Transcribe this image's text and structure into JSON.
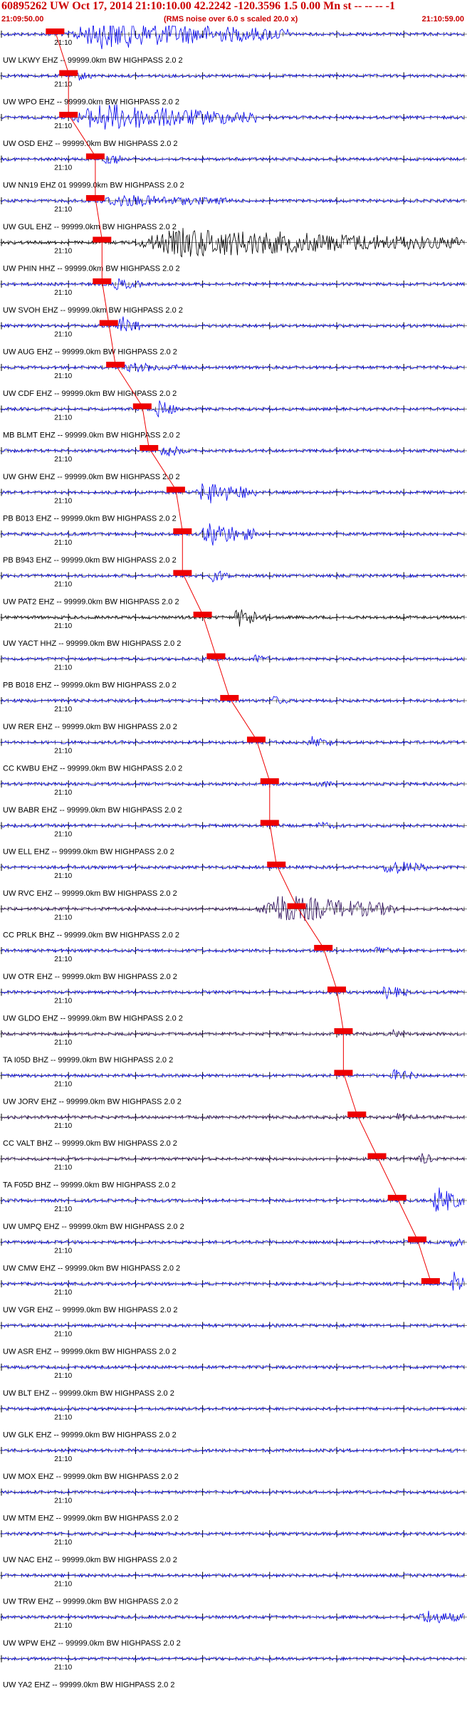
{
  "header": {
    "title": "60895262 UW Oct 17, 2014 21:10:10.00   42.2242 -120.3596  1.5 0.00 Mn st -- -- --  -1",
    "start_time": "21:09:50.00",
    "note": "(RMS noise over 6.0 s scaled 20.0 x)",
    "end_time": "21:10:59.00"
  },
  "colors": {
    "trace_blue": "#0000ee",
    "trace_black": "#000000",
    "trace_purple": "#2a0a5a",
    "pick_red": "#ee0000",
    "title_red": "#cc0000"
  },
  "chart_data": {
    "type": "line",
    "x_range": [
      "21:09:50.00",
      "21:10:59.00"
    ],
    "tick_label": "21:10",
    "traces": [
      {
        "label": "UW LKWY EHZ -- 99999.0km BW HIGHPASS  2.0  2",
        "color": "blue",
        "pick": "21:09:58",
        "amp": 0.95,
        "burst": [
          0.14,
          0.62
        ],
        "dark": false
      },
      {
        "label": "UW WPO EHZ -- 99999.0km BW HIGHPASS  2.0  2",
        "color": "blue",
        "pick": "21:10:00",
        "amp": 0.3,
        "burst": [
          0.15,
          0.2
        ],
        "dark": false
      },
      {
        "label": "UW OSD EHZ -- 99999.0km BW HIGHPASS  2.0  2",
        "color": "blue",
        "pick": "21:10:00",
        "amp": 0.9,
        "burst": [
          0.15,
          0.55
        ],
        "dark": false
      },
      {
        "label": "UW NN19 EHZ 01 99999.0km BW HIGHPASS  2.0  2",
        "color": "blue",
        "pick": "21:10:04",
        "amp": 0.45,
        "burst": [
          0.22,
          0.26
        ],
        "dark": false
      },
      {
        "label": "UW GUL EHZ -- 99999.0km BW HIGHPASS  2.0  2",
        "color": "blue",
        "pick": "21:10:04",
        "amp": 0.35,
        "burst": [
          0.2,
          0.5
        ],
        "dark": false
      },
      {
        "label": "UW PHIN HHZ -- 99999.0km BW HIGHPASS  2.0  2",
        "color": "black",
        "pick": "21:10:05",
        "amp": 0.95,
        "burst": [
          0.28,
          1.0
        ],
        "dark": true
      },
      {
        "label": "UW SVOH EHZ -- 99999.0km BW HIGHPASS  2.0  2",
        "color": "blue",
        "pick": "21:10:05",
        "amp": 0.35,
        "burst": [
          0.24,
          0.3
        ],
        "dark": false
      },
      {
        "label": "UW AUG EHZ -- 99999.0km BW HIGHPASS  2.0  2",
        "color": "blue",
        "pick": "21:10:06",
        "amp": 0.7,
        "burst": [
          0.25,
          0.3
        ],
        "dark": false
      },
      {
        "label": "UW CDF EHZ -- 99999.0km BW HIGHPASS  2.0  2",
        "color": "blue",
        "pick": "21:10:07",
        "amp": 0.25,
        "burst": [
          0.26,
          0.4
        ],
        "dark": false
      },
      {
        "label": "MB BLMT EHZ -- 99999.0km BW HIGHPASS  2.0  2",
        "color": "blue",
        "pick": "21:10:11",
        "amp": 0.55,
        "burst": [
          0.33,
          0.38
        ],
        "dark": false
      },
      {
        "label": "UW GHW EHZ -- 99999.0km BW HIGHPASS  2.0  2",
        "color": "blue",
        "pick": "21:10:12",
        "amp": 0.4,
        "burst": [
          0.34,
          0.4
        ],
        "dark": false
      },
      {
        "label": "PB B013 EHZ -- 99999.0km BW HIGHPASS  2.0  2",
        "color": "blue",
        "pick": "21:10:16",
        "amp": 0.75,
        "burst": [
          0.42,
          0.55
        ],
        "dark": false
      },
      {
        "label": "PB B943 EHZ -- 99999.0km BW HIGHPASS  2.0  2",
        "color": "blue",
        "pick": "21:10:17",
        "amp": 0.8,
        "burst": [
          0.43,
          0.55
        ],
        "dark": false
      },
      {
        "label": "UW PAT2 EHZ -- 99999.0km BW HIGHPASS  2.0  2",
        "color": "blue",
        "pick": "21:10:17",
        "amp": 0.4,
        "burst": [
          0.45,
          0.5
        ],
        "dark": false
      },
      {
        "label": "UW YACT HHZ -- 99999.0km BW HIGHPASS  2.0  2",
        "color": "black",
        "pick": "21:10:20",
        "amp": 0.6,
        "burst": [
          0.5,
          0.58
        ],
        "dark": true
      },
      {
        "label": "PB B018 EHZ -- 99999.0km BW HIGHPASS  2.0  2",
        "color": "blue",
        "pick": "21:10:22",
        "amp": 0.22,
        "burst": [
          0.54,
          0.58
        ],
        "dark": false
      },
      {
        "label": "UW RER EHZ -- 99999.0km BW HIGHPASS  2.0  2",
        "color": "blue",
        "pick": "21:10:24",
        "amp": 0.25,
        "burst": [
          0.58,
          0.62
        ],
        "dark": false
      },
      {
        "label": "CC KWBU EHZ -- 99999.0km BW HIGHPASS  2.0  2",
        "color": "blue",
        "pick": "21:10:28",
        "amp": 0.35,
        "burst": [
          0.66,
          0.72
        ],
        "dark": false
      },
      {
        "label": "UW BABR EHZ -- 99999.0km BW HIGHPASS  2.0  2",
        "color": "blue",
        "pick": "21:10:30",
        "amp": 0.2,
        "burst": [
          0.68,
          0.72
        ],
        "dark": false
      },
      {
        "label": "UW ELL EHZ -- 99999.0km BW HIGHPASS  2.0  2",
        "color": "blue",
        "pick": "21:10:30",
        "amp": 0.2,
        "burst": [
          0.68,
          0.72
        ],
        "dark": false
      },
      {
        "label": "UW RVC EHZ -- 99999.0km BW HIGHPASS  2.0  2",
        "color": "blue",
        "pick": "21:10:31",
        "amp": 0.45,
        "burst": [
          0.82,
          0.92
        ],
        "dark": false
      },
      {
        "label": "CC PRLK BHZ -- 99999.0km BW HIGHPASS  2.0  2",
        "color": "purple",
        "pick": "21:10:34",
        "amp": 0.95,
        "burst": [
          0.55,
          0.85
        ],
        "dark": true
      },
      {
        "label": "UW OTR EHZ -- 99999.0km BW HIGHPASS  2.0  2",
        "color": "blue",
        "pick": "21:10:38",
        "amp": 0.25,
        "burst": [
          0.8,
          0.86
        ],
        "dark": false
      },
      {
        "label": "UW GLDO EHZ -- 99999.0km BW HIGHPASS  2.0  2",
        "color": "blue",
        "pick": "21:10:40",
        "amp": 0.4,
        "burst": [
          0.82,
          0.88
        ],
        "dark": false
      },
      {
        "label": "TA I05D BHZ -- 99999.0km BW HIGHPASS  2.0  2",
        "color": "purple",
        "pick": "21:10:41",
        "amp": 0.2,
        "burst": [
          0.84,
          0.88
        ],
        "dark": true
      },
      {
        "label": "UW JORV EHZ -- 99999.0km BW HIGHPASS  2.0  2",
        "color": "blue",
        "pick": "21:10:41",
        "amp": 0.35,
        "burst": [
          0.84,
          0.9
        ],
        "dark": false
      },
      {
        "label": "CC VALT BHZ -- 99999.0km BW HIGHPASS  2.0  2",
        "color": "purple",
        "pick": "21:10:43",
        "amp": 0.25,
        "burst": [
          0.85,
          0.9
        ],
        "dark": true
      },
      {
        "label": "TA F05D BHZ -- 99999.0km BW HIGHPASS  2.0  2",
        "color": "purple",
        "pick": "21:10:46",
        "amp": 0.45,
        "burst": [
          0.9,
          0.93
        ],
        "dark": true
      },
      {
        "label": "UW UMPQ EHZ -- 99999.0km BW HIGHPASS  2.0  2",
        "color": "blue",
        "pick": "21:10:49",
        "amp": 0.95,
        "burst": [
          0.93,
          1.0
        ],
        "dark": false
      },
      {
        "label": "UW CMW EHZ -- 99999.0km BW HIGHPASS  2.0  2",
        "color": "blue",
        "pick": "21:10:52",
        "amp": 0.3,
        "burst": [
          0.96,
          1.0
        ],
        "dark": false
      },
      {
        "label": "UW VGR EHZ -- 99999.0km BW HIGHPASS  2.0  2",
        "color": "blue",
        "pick": "21:10:54",
        "amp": 0.9,
        "burst": [
          0.97,
          1.0
        ],
        "dark": false
      },
      {
        "label": "UW ASR EHZ -- 99999.0km BW HIGHPASS  2.0  2",
        "color": "blue",
        "pick": null,
        "amp": 0.15,
        "burst": null,
        "dark": false
      },
      {
        "label": "UW BLT EHZ -- 99999.0km BW HIGHPASS  2.0  2",
        "color": "blue",
        "pick": null,
        "amp": 0.2,
        "burst": null,
        "dark": false
      },
      {
        "label": "UW GLK EHZ -- 99999.0km BW HIGHPASS  2.0  2",
        "color": "blue",
        "pick": null,
        "amp": 0.2,
        "burst": null,
        "dark": false
      },
      {
        "label": "UW MOX EHZ -- 99999.0km BW HIGHPASS  2.0  2",
        "color": "blue",
        "pick": null,
        "amp": 0.2,
        "burst": null,
        "dark": false
      },
      {
        "label": "UW MTM EHZ -- 99999.0km BW HIGHPASS  2.0  2",
        "color": "blue",
        "pick": null,
        "amp": 0.15,
        "burst": null,
        "dark": false
      },
      {
        "label": "UW NAC EHZ -- 99999.0km BW HIGHPASS  2.0  2",
        "color": "blue",
        "pick": null,
        "amp": 0.15,
        "burst": null,
        "dark": false
      },
      {
        "label": "UW TRW EHZ -- 99999.0km BW HIGHPASS  2.0  2",
        "color": "blue",
        "pick": null,
        "amp": 0.15,
        "burst": null,
        "dark": false
      },
      {
        "label": "UW WPW EHZ -- 99999.0km BW HIGHPASS  2.0  2",
        "color": "blue",
        "pick": null,
        "amp": 0.45,
        "burst": [
          0.9,
          1.0
        ],
        "dark": false
      },
      {
        "label": "UW YA2 EHZ -- 99999.0km BW HIGHPASS  2.0  2",
        "color": "blue",
        "pick": null,
        "amp": 0.15,
        "burst": null,
        "dark": false
      }
    ]
  }
}
